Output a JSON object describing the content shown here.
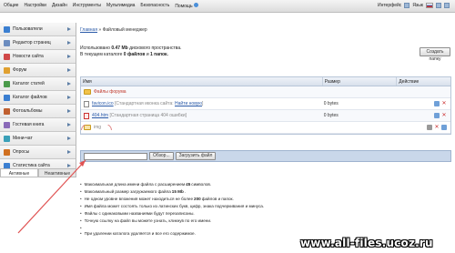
{
  "top_menu": [
    "Общие",
    "Настройки",
    "Дизайн",
    "Инструменты",
    "Мультимедиа",
    "Безопасность",
    "Помощь"
  ],
  "top_right": {
    "interface_label": "Интерфейс",
    "lang_label": "Язык"
  },
  "sidebar": {
    "items": [
      {
        "label": "Пользователи",
        "icon": "users-icon",
        "color": "#3b7fd1"
      },
      {
        "label": "Редактор страниц",
        "icon": "page-editor-icon",
        "color": "#6b8cbf"
      },
      {
        "label": "Новости сайта",
        "icon": "news-icon",
        "color": "#d04848"
      },
      {
        "label": "Форум",
        "icon": "forum-icon",
        "color": "#e0a030"
      },
      {
        "label": "Каталог статей",
        "icon": "articles-icon",
        "color": "#4a9a4a"
      },
      {
        "label": "Каталог файлов",
        "icon": "files-icon",
        "color": "#3b7fd1"
      },
      {
        "label": "Фотоальбомы",
        "icon": "photo-icon",
        "color": "#c06030"
      },
      {
        "label": "Гостевая книга",
        "icon": "guestbook-icon",
        "color": "#8a6ab8"
      },
      {
        "label": "Мини-чат",
        "icon": "chat-icon",
        "color": "#3aa0b8"
      },
      {
        "label": "Опросы",
        "icon": "polls-icon",
        "color": "#d07020"
      },
      {
        "label": "Статистика сайта",
        "icon": "stats-icon",
        "color": "#3b7fd1"
      }
    ],
    "tabs": [
      "Активные",
      "Неактивные"
    ]
  },
  "breadcrumb": {
    "home": "Главная",
    "sep": "»",
    "current": "Файловый менеджер"
  },
  "info": {
    "line1_pre": "Использовано",
    "used": "0.47 Mb",
    "line1_post": "дискового пространства.",
    "line2_pre": "В текущем каталоге",
    "files": "0 файлов",
    "and": "и",
    "folders": "1 папок."
  },
  "create_folder_button": "Создать папку",
  "table": {
    "headers": [
      "Имя",
      "Размер",
      "Действие"
    ],
    "rows": [
      {
        "kind": "folder",
        "name": "Файлы форума",
        "desc": "",
        "size": ""
      },
      {
        "kind": "file",
        "name": "favicon.ico",
        "desc": "[Стандартная иконка сайта:",
        "desc_link": "Найти новую",
        "desc_end": "]",
        "size": "0 bytes"
      },
      {
        "kind": "file",
        "name": "404.htm",
        "desc": "[Стандартная страница 404 ошибки]",
        "size": "0 bytes"
      },
      {
        "kind": "folder-new",
        "name": "img",
        "desc": "",
        "size": ""
      }
    ]
  },
  "upload": {
    "browse": "Обзор...",
    "submit": "Загрузить файл"
  },
  "notes": [
    {
      "pre": "Максимальная длина имени файла с расширением",
      "bold": "45",
      "post": "символов."
    },
    {
      "pre": "Максимальный размер загружаемого файла",
      "bold": "15 Mb",
      "post": "."
    },
    {
      "pre": "Не одном уровне вложения может находиться не более",
      "bold": "200",
      "post": "файлов и папок."
    },
    {
      "pre": "Имя файла может состоять только из латинских букв, цифр, знака подчеркивания и минуса.",
      "bold": "",
      "post": ""
    },
    {
      "pre": "Файлы с одинаковыми названиями будут перезаписаны.",
      "bold": "",
      "post": ""
    },
    {
      "pre": "Точную ссылку на файл вы можете узнать, кликнув по его имени.",
      "bold": "",
      "post": ""
    },
    {
      "pre": "При удалении каталога удаляется и все его содержимое.",
      "bold": "",
      "post": ""
    }
  ],
  "watermark": "www.all-files.ucoz.ru"
}
